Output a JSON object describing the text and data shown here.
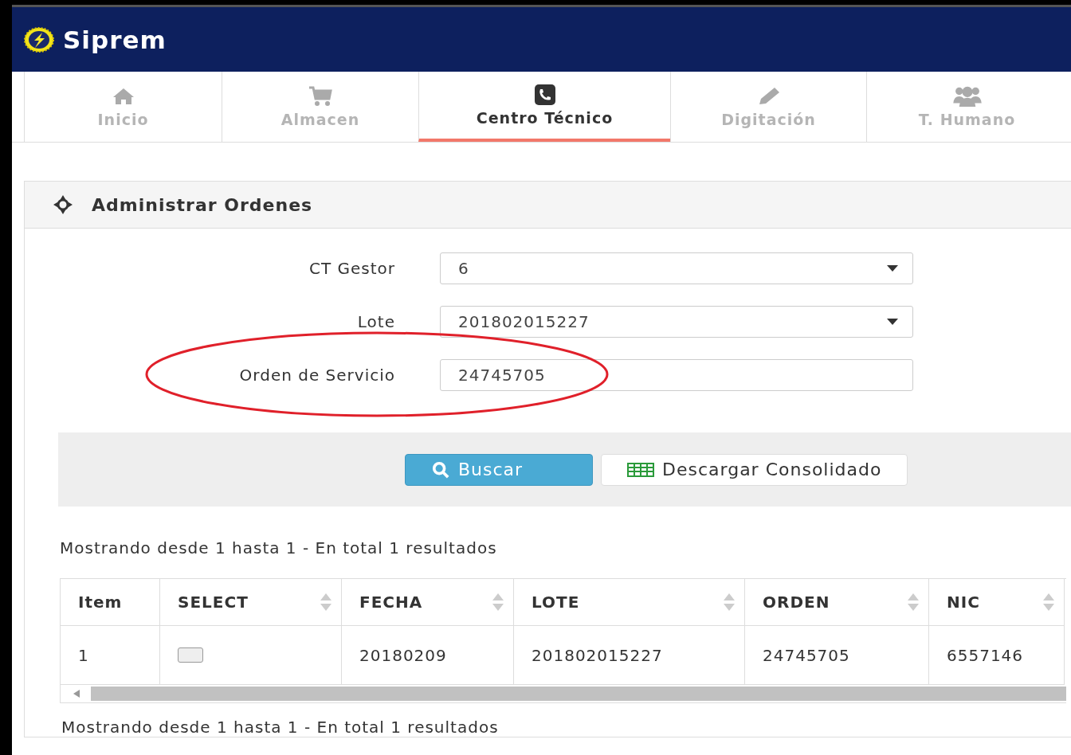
{
  "app": {
    "title": "Siprem"
  },
  "tabs": [
    {
      "label": "Inicio",
      "selected": false
    },
    {
      "label": "Almacen",
      "selected": false
    },
    {
      "label": "Centro Técnico",
      "selected": true
    },
    {
      "label": "Digitación",
      "selected": false
    },
    {
      "label": "T. Humano",
      "selected": false
    }
  ],
  "panel": {
    "title": "Administrar Ordenes",
    "fields": [
      {
        "label": "CT Gestor",
        "kind": "select",
        "value": "6"
      },
      {
        "label": "Lote",
        "kind": "select",
        "value": "201802015227"
      },
      {
        "label": "Orden de Servicio",
        "kind": "text",
        "value": "24745705"
      }
    ],
    "buttons": [
      {
        "label": "Buscar",
        "kind": "primary"
      },
      {
        "label": "Descargar Consolidado",
        "kind": "default"
      }
    ],
    "summary_top": "Mostrando desde 1 hasta 1 - En total 1 resultados",
    "table": {
      "columns": [
        {
          "label": "Item",
          "sortable": false
        },
        {
          "label": "SELECT",
          "sortable": true
        },
        {
          "label": "FECHA",
          "sortable": true
        },
        {
          "label": "LOTE",
          "sortable": true
        },
        {
          "label": "ORDEN",
          "sortable": true
        },
        {
          "label": "NIC",
          "sortable": true
        }
      ],
      "rows": [
        {
          "cells": [
            {
              "kind": "text",
              "text": "1"
            },
            {
              "kind": "checkbox",
              "checked": false
            },
            {
              "kind": "text",
              "text": "20180209"
            },
            {
              "kind": "text",
              "text": "201802015227"
            },
            {
              "kind": "text",
              "text": "24745705"
            },
            {
              "kind": "text",
              "text": "6557146"
            }
          ]
        }
      ]
    },
    "summary_bottom": "Mostrando desde 1 hasta 1 - En total 1 resultados"
  }
}
